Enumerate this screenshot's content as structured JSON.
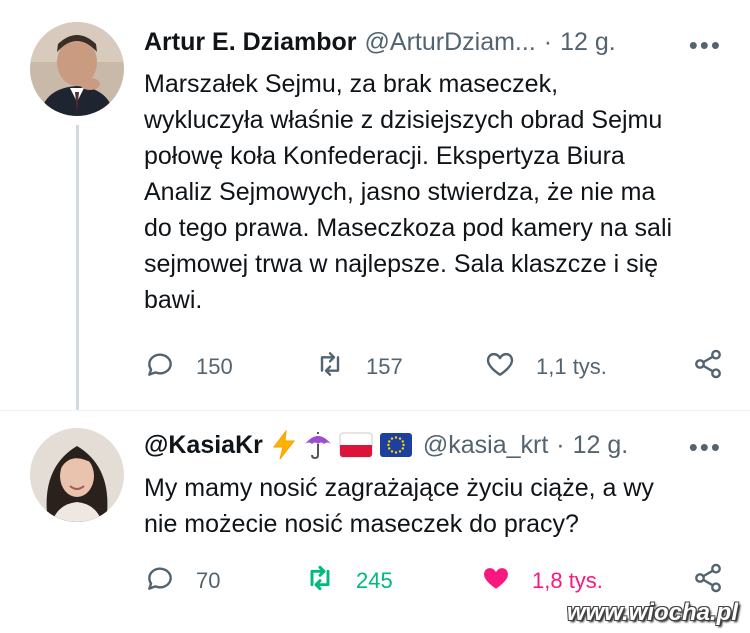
{
  "tweets": [
    {
      "name": "Artur E. Dziambor",
      "handle": "@ArturDziam...",
      "dot": "·",
      "time": "12 g.",
      "text": "Marszałek Sejmu, za brak maseczek, wykluczyła właśnie z dzisiejszych obrad Sejmu połowę koła Konfederacji. Ekspertyza Biura Analiz Sejmowych, jasno stwierdza, że nie ma do tego prawa. Maseczkoza pod kamery na sali sejmowej trwa w najlepsze. Sala klaszcze i się bawi.",
      "text_lines": [
        "Marszałek Sejmu, za brak maseczek,",
        "wykluczyła właśnie z dzisiejszych obrad Sejmu",
        "połowę koła Konfederacji. Ekspertyza Biura",
        "Analiz Sejmowych, jasno stwierdza, że nie ma",
        "do tego prawa. Maseczkoza pod kamery na sali",
        "sejmowej trwa w najlepsze. Sala klaszcze i się",
        "bawi."
      ],
      "replies": "150",
      "retweets": "157",
      "likes": "1,1 tys.",
      "liked": false,
      "retweeted": false
    },
    {
      "name": "@KasiaKr",
      "emojis": [
        "lightning-emoji",
        "umbrella-emoji",
        "poland-flag-emoji",
        "eu-flag-emoji"
      ],
      "handle": "@kasia_krt",
      "dot": "·",
      "time": "12 g.",
      "text_lines": [
        "My mamy nosić zagrażające życiu ciąże, a wy",
        "nie możecie nosić maseczek do pracy?"
      ],
      "replies": "70",
      "retweets": "245",
      "likes": "1,8 tys.",
      "liked": true,
      "retweeted": true
    }
  ],
  "more_label": "•••",
  "watermark": "www.wiocha.pl",
  "colors": {
    "text": "#0f1419",
    "secondary": "#536471",
    "retweet_active": "#00ba7c",
    "like_active": "#f91880",
    "thread_line": "#cfd9de"
  }
}
